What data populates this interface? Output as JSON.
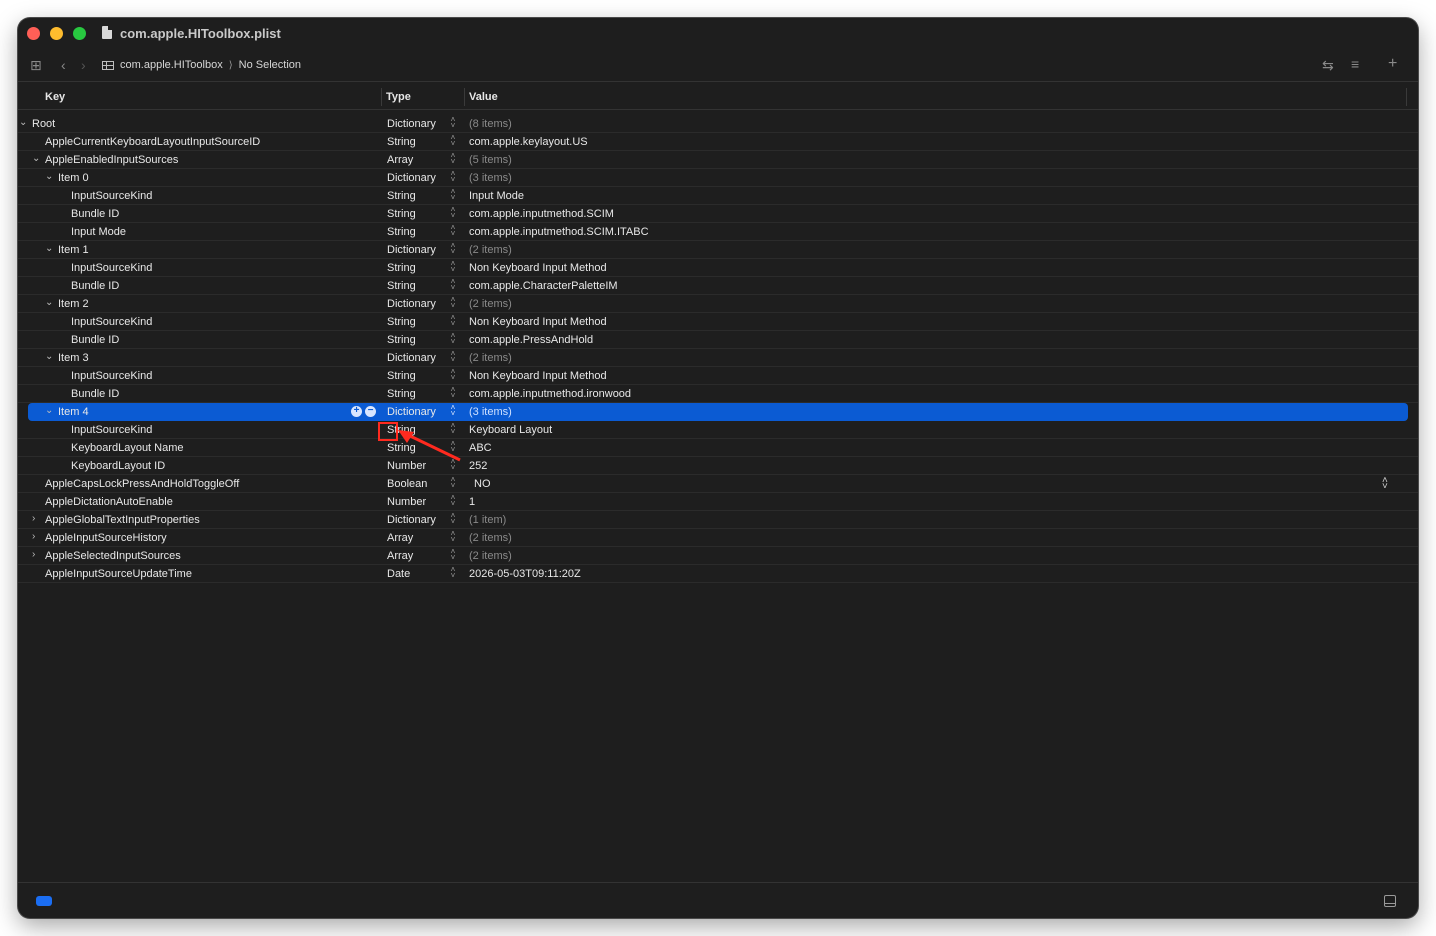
{
  "window": {
    "title": "com.apple.HIToolbox.plist"
  },
  "toolbar": {
    "breadcrumb": [
      "com.apple.HIToolbox",
      "No Selection"
    ],
    "icons": [
      "grid-icon",
      "back-icon",
      "forward-icon",
      "swap-icon",
      "lines-icon",
      "add-icon"
    ]
  },
  "columns": {
    "key": "Key",
    "type": "Type",
    "value": "Value"
  },
  "rows": [
    {
      "key": "Root",
      "type": "Dictionary",
      "value": "(8 items)",
      "level": 0,
      "expander": "open",
      "muted": true
    },
    {
      "key": "AppleCurrentKeyboardLayoutInputSourceID",
      "type": "String",
      "value": "com.apple.keylayout.US",
      "level": 1,
      "expander": "none",
      "muted": false
    },
    {
      "key": "AppleEnabledInputSources",
      "type": "Array",
      "value": "(5 items)",
      "level": 1,
      "expander": "open",
      "muted": true
    },
    {
      "key": "Item 0",
      "type": "Dictionary",
      "value": "(3 items)",
      "level": 2,
      "expander": "open",
      "muted": true
    },
    {
      "key": "InputSourceKind",
      "type": "String",
      "value": "Input Mode",
      "level": 3,
      "expander": "none",
      "muted": false
    },
    {
      "key": "Bundle ID",
      "type": "String",
      "value": "com.apple.inputmethod.SCIM",
      "level": 3,
      "expander": "none",
      "muted": false
    },
    {
      "key": "Input Mode",
      "type": "String",
      "value": "com.apple.inputmethod.SCIM.ITABC",
      "level": 3,
      "expander": "none",
      "muted": false
    },
    {
      "key": "Item 1",
      "type": "Dictionary",
      "value": "(2 items)",
      "level": 2,
      "expander": "open",
      "muted": true
    },
    {
      "key": "InputSourceKind",
      "type": "String",
      "value": "Non Keyboard Input Method",
      "level": 3,
      "expander": "none",
      "muted": false
    },
    {
      "key": "Bundle ID",
      "type": "String",
      "value": "com.apple.CharacterPaletteIM",
      "level": 3,
      "expander": "none",
      "muted": false
    },
    {
      "key": "Item 2",
      "type": "Dictionary",
      "value": "(2 items)",
      "level": 2,
      "expander": "open",
      "muted": true
    },
    {
      "key": "InputSourceKind",
      "type": "String",
      "value": "Non Keyboard Input Method",
      "level": 3,
      "expander": "none",
      "muted": false
    },
    {
      "key": "Bundle ID",
      "type": "String",
      "value": "com.apple.PressAndHold",
      "level": 3,
      "expander": "none",
      "muted": false
    },
    {
      "key": "Item 3",
      "type": "Dictionary",
      "value": "(2 items)",
      "level": 2,
      "expander": "open",
      "muted": true
    },
    {
      "key": "InputSourceKind",
      "type": "String",
      "value": "Non Keyboard Input Method",
      "level": 3,
      "expander": "none",
      "muted": false
    },
    {
      "key": "Bundle ID",
      "type": "String",
      "value": "com.apple.inputmethod.ironwood",
      "level": 3,
      "expander": "none",
      "muted": false
    },
    {
      "key": "Item 4",
      "type": "Dictionary",
      "value": "(3 items)",
      "level": 2,
      "expander": "open",
      "muted": true,
      "selected": true
    },
    {
      "key": "InputSourceKind",
      "type": "String",
      "value": "Keyboard Layout",
      "level": 3,
      "expander": "none",
      "muted": false
    },
    {
      "key": "KeyboardLayout Name",
      "type": "String",
      "value": "ABC",
      "level": 3,
      "expander": "none",
      "muted": false
    },
    {
      "key": "KeyboardLayout ID",
      "type": "Number",
      "value": "252",
      "level": 3,
      "expander": "none",
      "muted": false
    },
    {
      "key": "AppleCapsLockPressAndHoldToggleOff",
      "type": "Boolean",
      "value": "NO",
      "level": 1,
      "expander": "none",
      "muted": false,
      "popup": true
    },
    {
      "key": "AppleDictationAutoEnable",
      "type": "Number",
      "value": "1",
      "level": 1,
      "expander": "none",
      "muted": false
    },
    {
      "key": "AppleGlobalTextInputProperties",
      "type": "Dictionary",
      "value": "(1 item)",
      "level": 1,
      "expander": "closed",
      "muted": true
    },
    {
      "key": "AppleInputSourceHistory",
      "type": "Array",
      "value": "(2 items)",
      "level": 1,
      "expander": "closed",
      "muted": true
    },
    {
      "key": "AppleSelectedInputSources",
      "type": "Array",
      "value": "(2 items)",
      "level": 1,
      "expander": "closed",
      "muted": true
    },
    {
      "key": "AppleInputSourceUpdateTime",
      "type": "Date",
      "value": "2026-05-03T09:11:20Z",
      "level": 1,
      "expander": "none",
      "muted": false
    }
  ],
  "colors": {
    "selection": "#0b5bd3",
    "annotation": "#ff2a1f",
    "background": "#1e1e1e"
  }
}
